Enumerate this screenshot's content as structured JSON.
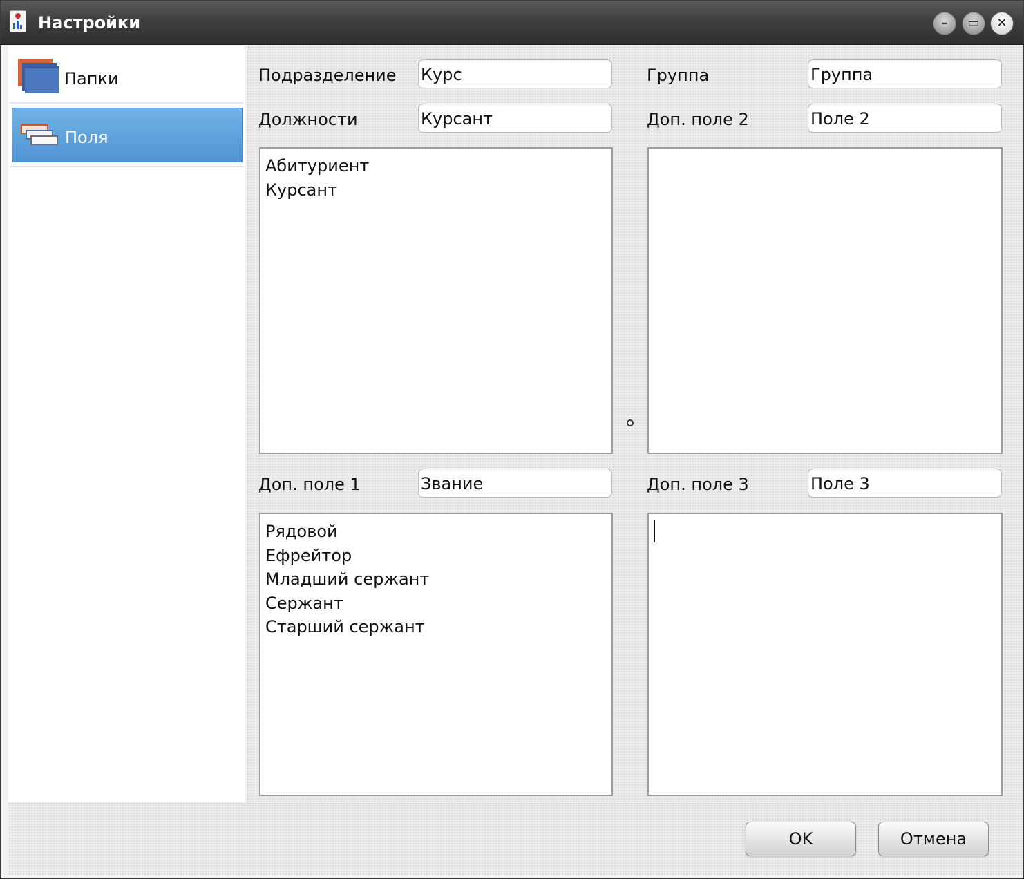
{
  "window": {
    "title": "Настройки",
    "controls": {
      "minimize": "–",
      "maximize": "▭",
      "close": "✕"
    }
  },
  "nav": {
    "items": [
      {
        "label": "Папки",
        "icon": "folders-icon",
        "selected": false
      },
      {
        "label": "Поля",
        "icon": "fields-icon",
        "selected": true
      }
    ],
    "selected_color": "#5a9fdc"
  },
  "fields": {
    "subdivision": {
      "label": "Подразделение",
      "value": "Курс"
    },
    "group": {
      "label": "Группа",
      "value": "Группа"
    },
    "positions": {
      "label": "Должности",
      "value": "Курсант",
      "items": [
        "Абитуриент",
        "Курсант"
      ]
    },
    "extra2": {
      "label": "Доп. поле 2",
      "value": "Поле 2",
      "items": []
    },
    "extra1": {
      "label": "Доп. поле 1",
      "value": "Звание",
      "items": [
        "Рядовой",
        "Ефрейтор",
        "Младший сержант",
        "Сержант",
        "Старший сержант"
      ]
    },
    "extra3": {
      "label": "Доп. поле 3",
      "value": "Поле 3",
      "items": []
    }
  },
  "buttons": {
    "ok": "OK",
    "cancel": "Отмена"
  }
}
